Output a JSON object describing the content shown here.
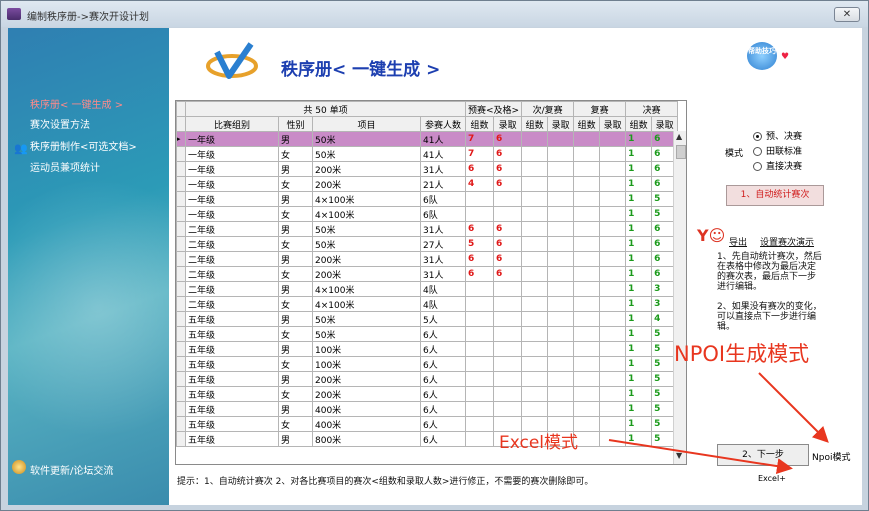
{
  "window": {
    "title": "编制秩序册->赛次开设计划",
    "close_label": "✕"
  },
  "sidebar": {
    "items": [
      {
        "label": "秩序册< 一键生成 >",
        "active": true
      },
      {
        "label": "赛次设置方法",
        "active": false
      },
      {
        "label": "秩序册制作<可选文档>",
        "active": false
      },
      {
        "label": "运动员兼项统计",
        "active": false
      }
    ],
    "bottom_label": "软件更新/论坛交流"
  },
  "header": {
    "title": "秩序册< 一键生成 >",
    "help_label": "帮助技巧"
  },
  "table": {
    "summary": "共  50  单项",
    "group_headers": [
      "预赛<及格>",
      "次/复赛",
      "复赛",
      "决赛"
    ],
    "columns": [
      "比赛组别",
      "性别",
      "项目",
      "参赛人数",
      "组数",
      "录取",
      "组数",
      "录取",
      "组数",
      "录取",
      "组数",
      "录取"
    ],
    "rows": [
      [
        "一年级",
        "男",
        "50米",
        "41人",
        "7",
        "6",
        "",
        "",
        "",
        "",
        "1",
        "6"
      ],
      [
        "一年级",
        "女",
        "50米",
        "41人",
        "7",
        "6",
        "",
        "",
        "",
        "",
        "1",
        "6"
      ],
      [
        "一年级",
        "男",
        "200米",
        "31人",
        "6",
        "6",
        "",
        "",
        "",
        "",
        "1",
        "6"
      ],
      [
        "一年级",
        "女",
        "200米",
        "21人",
        "4",
        "6",
        "",
        "",
        "",
        "",
        "1",
        "6"
      ],
      [
        "一年级",
        "男",
        "4×100米",
        "6队",
        "",
        "",
        "",
        "",
        "",
        "",
        "1",
        "5"
      ],
      [
        "一年级",
        "女",
        "4×100米",
        "6队",
        "",
        "",
        "",
        "",
        "",
        "",
        "1",
        "5"
      ],
      [
        "二年级",
        "男",
        "50米",
        "31人",
        "6",
        "6",
        "",
        "",
        "",
        "",
        "1",
        "6"
      ],
      [
        "二年级",
        "女",
        "50米",
        "27人",
        "5",
        "6",
        "",
        "",
        "",
        "",
        "1",
        "6"
      ],
      [
        "二年级",
        "男",
        "200米",
        "31人",
        "6",
        "6",
        "",
        "",
        "",
        "",
        "1",
        "6"
      ],
      [
        "二年级",
        "女",
        "200米",
        "31人",
        "6",
        "6",
        "",
        "",
        "",
        "",
        "1",
        "6"
      ],
      [
        "二年级",
        "男",
        "4×100米",
        "4队",
        "",
        "",
        "",
        "",
        "",
        "",
        "1",
        "3"
      ],
      [
        "二年级",
        "女",
        "4×100米",
        "4队",
        "",
        "",
        "",
        "",
        "",
        "",
        "1",
        "3"
      ],
      [
        "五年级",
        "男",
        "50米",
        "5人",
        "",
        "",
        "",
        "",
        "",
        "",
        "1",
        "4"
      ],
      [
        "五年级",
        "女",
        "50米",
        "6人",
        "",
        "",
        "",
        "",
        "",
        "",
        "1",
        "5"
      ],
      [
        "五年级",
        "男",
        "100米",
        "6人",
        "",
        "",
        "",
        "",
        "",
        "",
        "1",
        "5"
      ],
      [
        "五年级",
        "女",
        "100米",
        "6人",
        "",
        "",
        "",
        "",
        "",
        "",
        "1",
        "5"
      ],
      [
        "五年级",
        "男",
        "200米",
        "6人",
        "",
        "",
        "",
        "",
        "",
        "",
        "1",
        "5"
      ],
      [
        "五年级",
        "女",
        "200米",
        "6人",
        "",
        "",
        "",
        "",
        "",
        "",
        "1",
        "5"
      ],
      [
        "五年级",
        "男",
        "400米",
        "6人",
        "",
        "",
        "",
        "",
        "",
        "",
        "1",
        "5"
      ],
      [
        "五年级",
        "女",
        "400米",
        "6人",
        "",
        "",
        "",
        "",
        "",
        "",
        "1",
        "5"
      ],
      [
        "五年级",
        "男",
        "800米",
        "6人",
        "",
        "",
        "",
        "",
        "",
        "",
        "1",
        "5"
      ]
    ]
  },
  "hint": "提示：1、自动统计赛次    2、对各比赛项目的赛次<组数和录取人数>进行修正，不需要的赛次删除即可。",
  "mode": {
    "label": "模式",
    "options": [
      {
        "label": "预、决赛",
        "checked": true
      },
      {
        "label": "田联标准",
        "checked": false
      },
      {
        "label": "直接决赛",
        "checked": false
      }
    ]
  },
  "actions": {
    "auto_count": "1、自动统计赛次",
    "export_link": "导出",
    "demo_link": "设置赛次演示",
    "next": "2、下一步",
    "npoi_mode": "Npoi模式",
    "excel_mode": "Excel+"
  },
  "description": "1、先自动统计赛次，然后在表格中修改为最后决定的赛次表，最后点下一步进行编辑。\n\n2、如果没有赛次的变化，可以直接点下一步进行编辑。",
  "annotations": {
    "npoi": "NPOI生成模式",
    "excel": "Excel模式"
  }
}
